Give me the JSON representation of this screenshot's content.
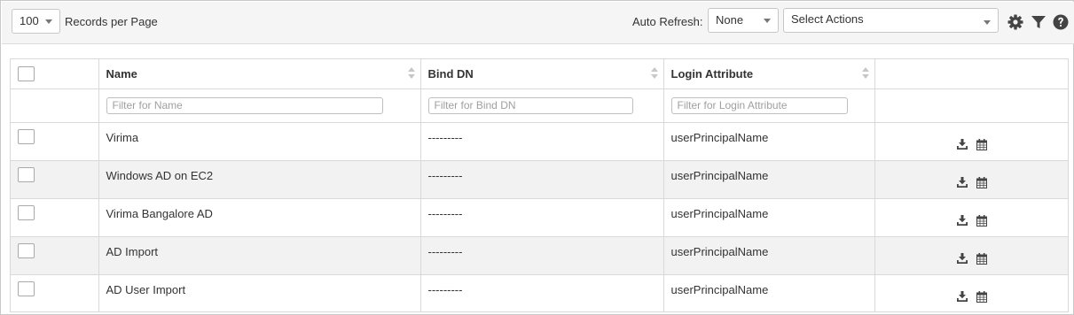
{
  "toolbar": {
    "records_per_page_value": "100",
    "records_per_page_label": "Records per Page",
    "auto_refresh_label": "Auto Refresh:",
    "auto_refresh_value": "None",
    "actions_value": "Select Actions",
    "icons": [
      "gear-icon",
      "filter-icon",
      "help-icon"
    ]
  },
  "table": {
    "columns": [
      {
        "label": "Name",
        "filter_placeholder": "Filter for Name"
      },
      {
        "label": "Bind DN",
        "filter_placeholder": "Filter for Bind DN"
      },
      {
        "label": "Login Attribute",
        "filter_placeholder": "Filter for Login Attribute"
      }
    ],
    "rows": [
      {
        "name": "Virima",
        "bind_dn": "---------",
        "login_attribute": "userPrincipalName"
      },
      {
        "name": "Windows AD on EC2",
        "bind_dn": "---------",
        "login_attribute": "userPrincipalName"
      },
      {
        "name": "Virima Bangalore AD",
        "bind_dn": "---------",
        "login_attribute": "userPrincipalName"
      },
      {
        "name": "AD Import",
        "bind_dn": "---------",
        "login_attribute": "userPrincipalName"
      },
      {
        "name": "AD User Import",
        "bind_dn": "---------",
        "login_attribute": "userPrincipalName"
      }
    ],
    "row_action_icons": [
      "download-icon",
      "calendar-icon"
    ]
  },
  "colors": {
    "toolbar_bg": "#f5f5f5",
    "alt_row_bg": "#f2f2f2",
    "border": "#d9d9d9",
    "icon": "#444444"
  }
}
